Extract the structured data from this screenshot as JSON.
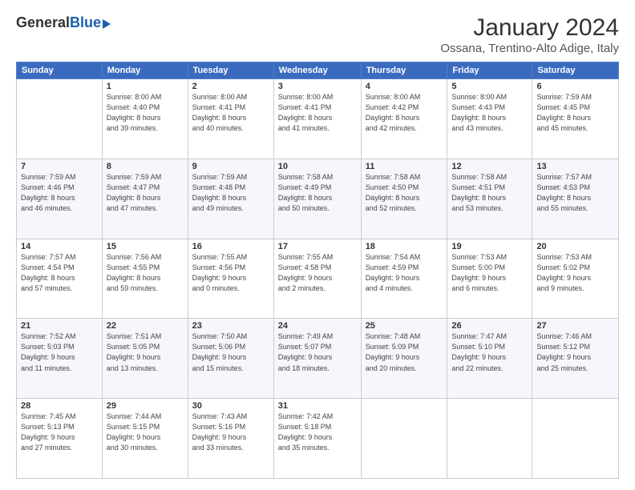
{
  "logo": {
    "general": "General",
    "blue": "Blue"
  },
  "title": "January 2024",
  "subtitle": "Ossana, Trentino-Alto Adige, Italy",
  "days_header": [
    "Sunday",
    "Monday",
    "Tuesday",
    "Wednesday",
    "Thursday",
    "Friday",
    "Saturday"
  ],
  "weeks": [
    [
      {
        "day": "",
        "info": ""
      },
      {
        "day": "1",
        "info": "Sunrise: 8:00 AM\nSunset: 4:40 PM\nDaylight: 8 hours\nand 39 minutes."
      },
      {
        "day": "2",
        "info": "Sunrise: 8:00 AM\nSunset: 4:41 PM\nDaylight: 8 hours\nand 40 minutes."
      },
      {
        "day": "3",
        "info": "Sunrise: 8:00 AM\nSunset: 4:41 PM\nDaylight: 8 hours\nand 41 minutes."
      },
      {
        "day": "4",
        "info": "Sunrise: 8:00 AM\nSunset: 4:42 PM\nDaylight: 8 hours\nand 42 minutes."
      },
      {
        "day": "5",
        "info": "Sunrise: 8:00 AM\nSunset: 4:43 PM\nDaylight: 8 hours\nand 43 minutes."
      },
      {
        "day": "6",
        "info": "Sunrise: 7:59 AM\nSunset: 4:45 PM\nDaylight: 8 hours\nand 45 minutes."
      }
    ],
    [
      {
        "day": "7",
        "info": "Sunrise: 7:59 AM\nSunset: 4:46 PM\nDaylight: 8 hours\nand 46 minutes."
      },
      {
        "day": "8",
        "info": "Sunrise: 7:59 AM\nSunset: 4:47 PM\nDaylight: 8 hours\nand 47 minutes."
      },
      {
        "day": "9",
        "info": "Sunrise: 7:59 AM\nSunset: 4:48 PM\nDaylight: 8 hours\nand 49 minutes."
      },
      {
        "day": "10",
        "info": "Sunrise: 7:58 AM\nSunset: 4:49 PM\nDaylight: 8 hours\nand 50 minutes."
      },
      {
        "day": "11",
        "info": "Sunrise: 7:58 AM\nSunset: 4:50 PM\nDaylight: 8 hours\nand 52 minutes."
      },
      {
        "day": "12",
        "info": "Sunrise: 7:58 AM\nSunset: 4:51 PM\nDaylight: 8 hours\nand 53 minutes."
      },
      {
        "day": "13",
        "info": "Sunrise: 7:57 AM\nSunset: 4:53 PM\nDaylight: 8 hours\nand 55 minutes."
      }
    ],
    [
      {
        "day": "14",
        "info": "Sunrise: 7:57 AM\nSunset: 4:54 PM\nDaylight: 8 hours\nand 57 minutes."
      },
      {
        "day": "15",
        "info": "Sunrise: 7:56 AM\nSunset: 4:55 PM\nDaylight: 8 hours\nand 59 minutes."
      },
      {
        "day": "16",
        "info": "Sunrise: 7:55 AM\nSunset: 4:56 PM\nDaylight: 9 hours\nand 0 minutes."
      },
      {
        "day": "17",
        "info": "Sunrise: 7:55 AM\nSunset: 4:58 PM\nDaylight: 9 hours\nand 2 minutes."
      },
      {
        "day": "18",
        "info": "Sunrise: 7:54 AM\nSunset: 4:59 PM\nDaylight: 9 hours\nand 4 minutes."
      },
      {
        "day": "19",
        "info": "Sunrise: 7:53 AM\nSunset: 5:00 PM\nDaylight: 9 hours\nand 6 minutes."
      },
      {
        "day": "20",
        "info": "Sunrise: 7:53 AM\nSunset: 5:02 PM\nDaylight: 9 hours\nand 9 minutes."
      }
    ],
    [
      {
        "day": "21",
        "info": "Sunrise: 7:52 AM\nSunset: 5:03 PM\nDaylight: 9 hours\nand 11 minutes."
      },
      {
        "day": "22",
        "info": "Sunrise: 7:51 AM\nSunset: 5:05 PM\nDaylight: 9 hours\nand 13 minutes."
      },
      {
        "day": "23",
        "info": "Sunrise: 7:50 AM\nSunset: 5:06 PM\nDaylight: 9 hours\nand 15 minutes."
      },
      {
        "day": "24",
        "info": "Sunrise: 7:49 AM\nSunset: 5:07 PM\nDaylight: 9 hours\nand 18 minutes."
      },
      {
        "day": "25",
        "info": "Sunrise: 7:48 AM\nSunset: 5:09 PM\nDaylight: 9 hours\nand 20 minutes."
      },
      {
        "day": "26",
        "info": "Sunrise: 7:47 AM\nSunset: 5:10 PM\nDaylight: 9 hours\nand 22 minutes."
      },
      {
        "day": "27",
        "info": "Sunrise: 7:46 AM\nSunset: 5:12 PM\nDaylight: 9 hours\nand 25 minutes."
      }
    ],
    [
      {
        "day": "28",
        "info": "Sunrise: 7:45 AM\nSunset: 5:13 PM\nDaylight: 9 hours\nand 27 minutes."
      },
      {
        "day": "29",
        "info": "Sunrise: 7:44 AM\nSunset: 5:15 PM\nDaylight: 9 hours\nand 30 minutes."
      },
      {
        "day": "30",
        "info": "Sunrise: 7:43 AM\nSunset: 5:16 PM\nDaylight: 9 hours\nand 33 minutes."
      },
      {
        "day": "31",
        "info": "Sunrise: 7:42 AM\nSunset: 5:18 PM\nDaylight: 9 hours\nand 35 minutes."
      },
      {
        "day": "",
        "info": ""
      },
      {
        "day": "",
        "info": ""
      },
      {
        "day": "",
        "info": ""
      }
    ]
  ]
}
